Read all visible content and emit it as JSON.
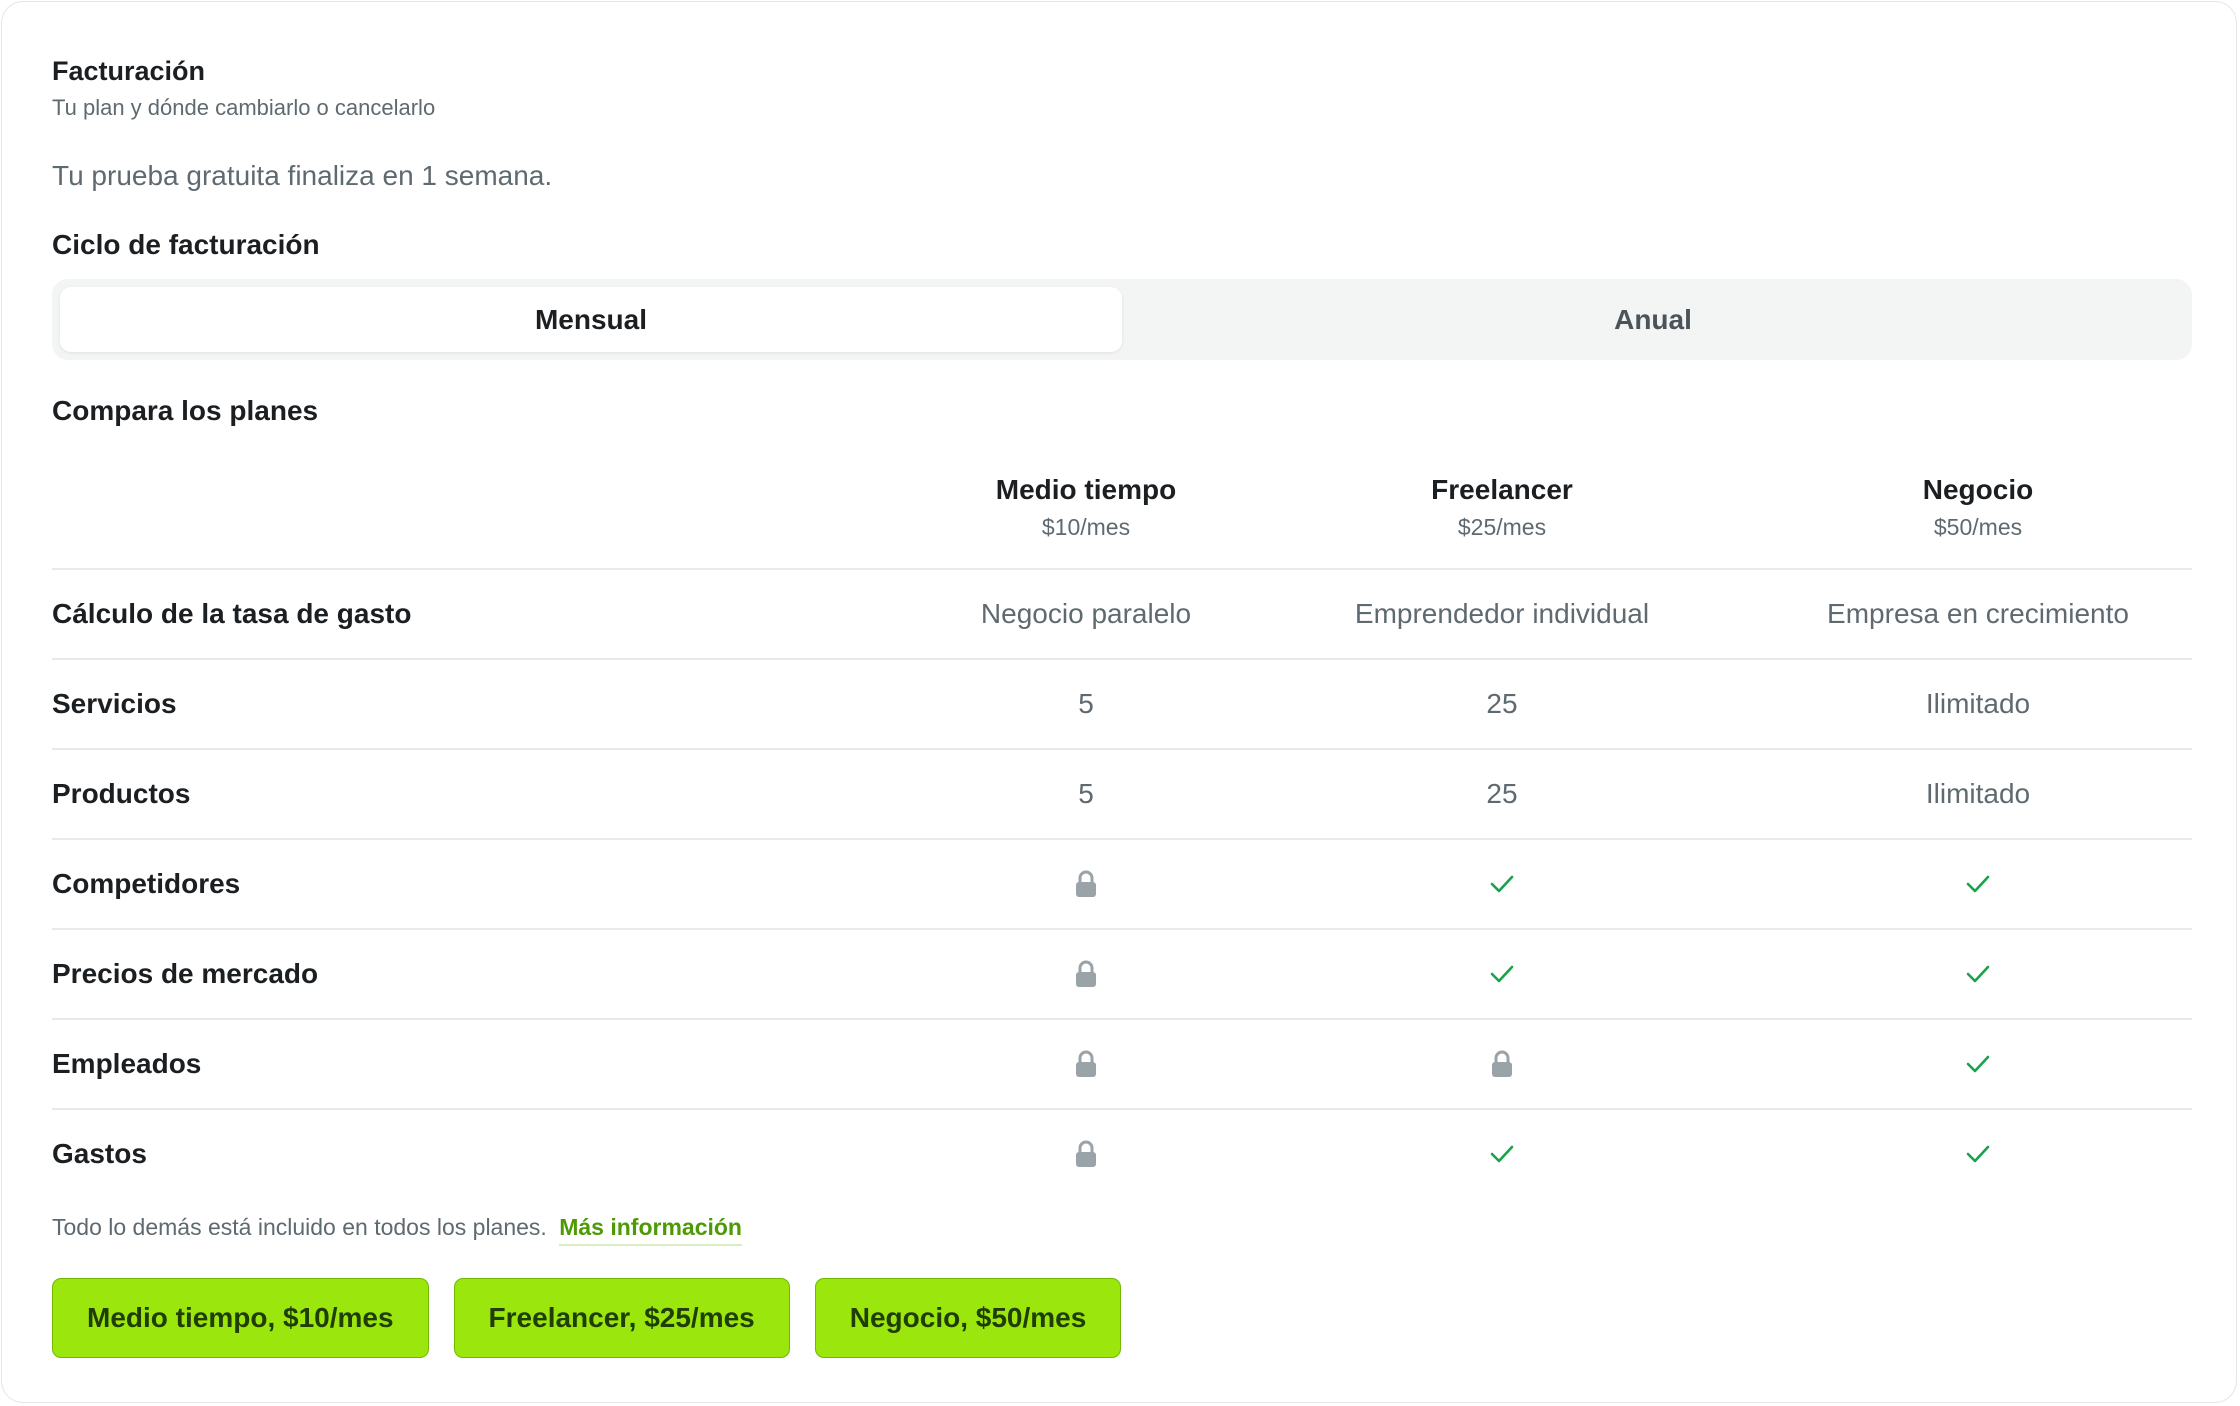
{
  "billing": {
    "title": "Facturación",
    "subtitle": "Tu plan y dónde cambiarlo o cancelarlo",
    "trial_notice": "Tu prueba gratuita finaliza en 1 semana."
  },
  "cycle": {
    "label": "Ciclo de facturación",
    "options": [
      "Mensual",
      "Anual"
    ],
    "selected": "Mensual"
  },
  "compare": {
    "label": "Compara los planes",
    "plans": [
      {
        "name": "Medio tiempo",
        "price": "$10/mes"
      },
      {
        "name": "Freelancer",
        "price": "$25/mes"
      },
      {
        "name": "Negocio",
        "price": "$50/mes"
      }
    ],
    "rows": [
      {
        "label": "Cálculo de la tasa de gasto",
        "values": [
          "Negocio paralelo",
          "Emprendedor individual",
          "Empresa en crecimiento"
        ]
      },
      {
        "label": "Servicios",
        "values": [
          "5",
          "25",
          "Ilimitado"
        ]
      },
      {
        "label": "Productos",
        "values": [
          "5",
          "25",
          "Ilimitado"
        ]
      },
      {
        "label": "Competidores",
        "icons": [
          "lock-icon",
          "check-icon",
          "check-icon"
        ]
      },
      {
        "label": "Precios de mercado",
        "icons": [
          "lock-icon",
          "check-icon",
          "check-icon"
        ]
      },
      {
        "label": "Empleados",
        "icons": [
          "lock-icon",
          "lock-icon",
          "check-icon"
        ]
      },
      {
        "label": "Gastos",
        "icons": [
          "lock-icon",
          "check-icon",
          "check-icon"
        ]
      }
    ]
  },
  "footer": {
    "note": "Todo lo demás está incluido en todos los planes.",
    "link": "Más información"
  },
  "buttons": [
    "Medio tiempo, $10/mes",
    "Freelancer, $25/mes",
    "Negocio, $50/mes"
  ],
  "colors": {
    "accent": "#9be60c",
    "check": "#16a34a",
    "lock": "#9aa3a8",
    "link": "#4e9a06"
  }
}
